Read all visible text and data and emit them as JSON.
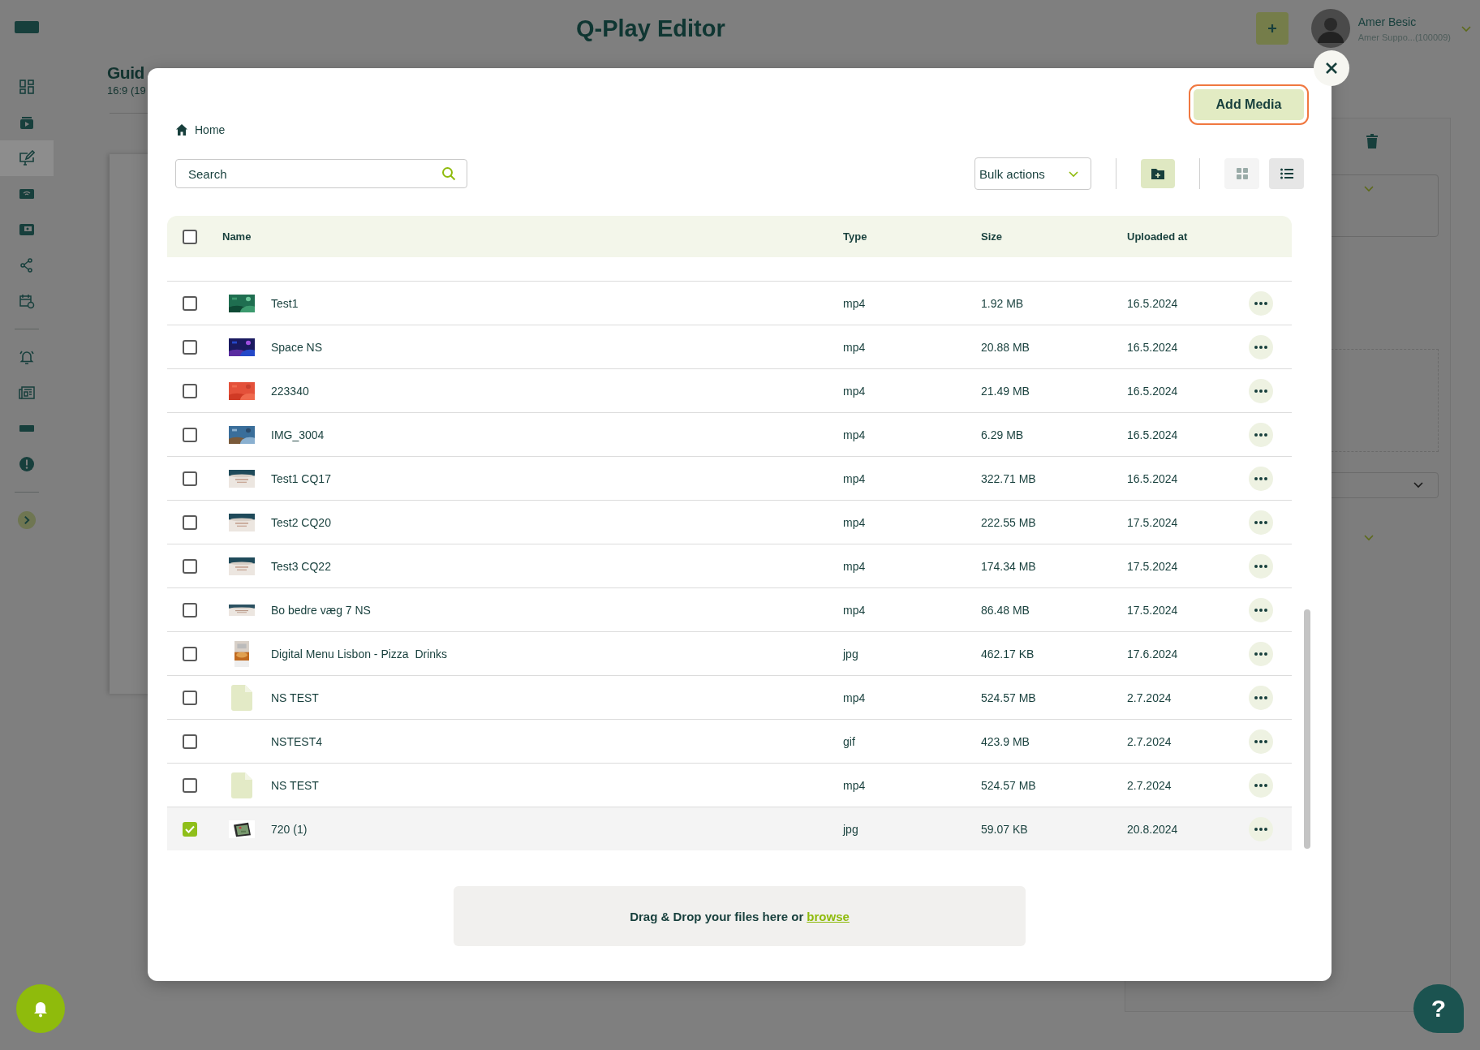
{
  "app": {
    "title": "Q-Play Editor",
    "user_name": "Amer Besic",
    "user_account": "Amer Suppo...(100009)"
  },
  "page": {
    "title": "Guid",
    "subtitle": "16:9 (19"
  },
  "sidebar": {
    "groups": [
      {
        "items": [
          {
            "kind": "dashboard",
            "selected": false
          },
          {
            "kind": "playlist",
            "selected": false
          },
          {
            "kind": "editor",
            "selected": true
          },
          {
            "kind": "screens",
            "selected": false
          },
          {
            "kind": "media",
            "selected": false
          },
          {
            "kind": "share",
            "selected": false
          },
          {
            "kind": "schedule",
            "selected": false
          }
        ]
      },
      {
        "items": [
          {
            "kind": "alarm",
            "selected": false
          },
          {
            "kind": "news",
            "selected": false
          },
          {
            "kind": "display",
            "selected": false
          },
          {
            "kind": "alert",
            "selected": false
          }
        ]
      },
      {
        "items": [
          {
            "kind": "expand",
            "selected": false
          }
        ]
      }
    ]
  },
  "modal": {
    "breadcrumb": "Home",
    "add_button": "Add Media",
    "search": {
      "placeholder": "Search"
    },
    "bulk_actions": "Bulk actions",
    "views": [
      {
        "kind": "grid",
        "selected": false
      },
      {
        "kind": "list",
        "selected": true
      }
    ],
    "table": {
      "select_all": false,
      "columns": [
        "Name",
        "Type",
        "Size",
        "Uploaded at"
      ],
      "rows": [
        {
          "kind": "picture",
          "name": "Test1",
          "type": "mp4",
          "size": "1.92 MB",
          "uploaded": "16.5.2024",
          "checked": false
        },
        {
          "kind": "picture",
          "name": "Space NS",
          "type": "mp4",
          "size": "20.88 MB",
          "uploaded": "16.5.2024",
          "checked": false
        },
        {
          "kind": "picture",
          "name": "223340",
          "type": "mp4",
          "size": "21.49 MB",
          "uploaded": "16.5.2024",
          "checked": false
        },
        {
          "kind": "picture",
          "name": "IMG_3004",
          "type": "mp4",
          "size": "6.29 MB",
          "uploaded": "16.5.2024",
          "checked": false
        },
        {
          "kind": "picture",
          "name": "Test1 CQ17",
          "type": "mp4",
          "size": "322.71 MB",
          "uploaded": "16.5.2024",
          "checked": false
        },
        {
          "kind": "picture",
          "name": "Test2 CQ20",
          "type": "mp4",
          "size": "222.55 MB",
          "uploaded": "17.5.2024",
          "checked": false
        },
        {
          "kind": "picture",
          "name": "Test3 CQ22",
          "type": "mp4",
          "size": "174.34 MB",
          "uploaded": "17.5.2024",
          "checked": false
        },
        {
          "kind": "picture",
          "name": "Bo bedre væg 7 NS",
          "type": "mp4",
          "size": "86.48 MB",
          "uploaded": "17.5.2024",
          "checked": false
        },
        {
          "kind": "picture",
          "name": "Digital Menu Lisbon - Pizza  Drinks",
          "type": "jpg",
          "size": "462.17 KB",
          "uploaded": "17.6.2024",
          "checked": false
        },
        {
          "kind": "file",
          "name": "NS TEST",
          "type": "mp4",
          "size": "524.57 MB",
          "uploaded": "2.7.2024",
          "checked": false
        },
        {
          "kind": "none",
          "name": "NSTEST4",
          "type": "gif",
          "size": "423.9 MB",
          "uploaded": "2.7.2024",
          "checked": false
        },
        {
          "kind": "file",
          "name": "NS TEST",
          "type": "mp4",
          "size": "524.57 MB",
          "uploaded": "2.7.2024",
          "checked": false
        },
        {
          "kind": "picture",
          "name": "720 (1)",
          "type": "jpg",
          "size": "59.07 KB",
          "uploaded": "20.8.2024",
          "checked": true
        }
      ]
    },
    "drop_text": "Drag & Drop your files here or",
    "drop_link": "browse"
  },
  "help_label": "?"
}
